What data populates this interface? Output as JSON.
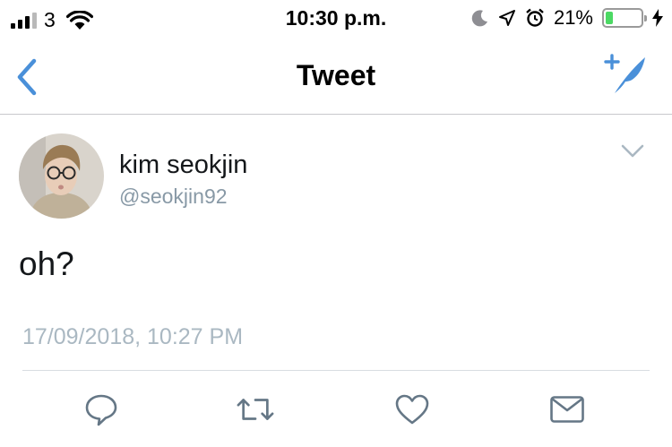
{
  "status_bar": {
    "carrier": "3",
    "time": "10:30 p.m.",
    "battery_percent": "21%",
    "battery_level": 0.21,
    "signal_bars_on": 3,
    "signal_bars_total": 4,
    "icons": [
      "signal-icon",
      "wifi-icon",
      "moon-icon",
      "location-icon",
      "alarm-icon",
      "battery-icon",
      "charging-icon"
    ]
  },
  "nav": {
    "title": "Tweet",
    "back_icon": "chevron-left-icon",
    "compose_icon": "compose-tweet-icon",
    "accent": "#4a90d9"
  },
  "tweet": {
    "display_name": "kim seokjin",
    "handle": "@seokjin92",
    "text": "oh?",
    "timestamp": "17/09/2018, 10:27 PM",
    "menu_icon": "chevron-down-icon"
  },
  "actions": {
    "icons": [
      "reply-icon",
      "retweet-icon",
      "like-icon",
      "share-dm-icon"
    ]
  },
  "colors": {
    "text_primary": "#14171a",
    "text_secondary": "#8899a6",
    "timestamp": "#aab8c2",
    "icon_gray": "#657786",
    "battery_green": "#4cd964"
  }
}
